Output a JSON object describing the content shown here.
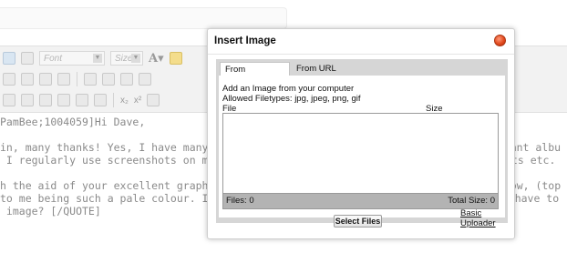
{
  "editor": {
    "font_select": "Font",
    "size_select": "Size",
    "post_lines": [
      "PamBee;1004059]Hi Dave,",
      "",
      "in, many thanks! Yes, I have many 'screenshot",
      " I regularly use screenshots on my laptop, to",
      "",
      "h the aid of your excellent graphic descripti",
      "to me being such a pale colour. Is there an '",
      " image? [/QUOTE]"
    ],
    "post_right_fragments": [
      "elevant albu",
      "ots etc.",
      "arrow, (top",
      "one have to"
    ]
  },
  "dialog": {
    "title": "Insert Image",
    "tabs": [
      {
        "label": "From Computer",
        "active": true
      },
      {
        "label": "From URL",
        "active": false
      }
    ],
    "heading": "Add an Image from your computer",
    "allowed": "Allowed Filetypes: jpg, jpeg, png, gif",
    "col_file": "File",
    "col_size": "Size",
    "files_count": "Files: 0",
    "total_size": "Total Size: 0",
    "select_button": "Select Files",
    "basic_link_line1": "Basic",
    "basic_link_line2": "Uploader",
    "close_color": "#e24a1e"
  }
}
